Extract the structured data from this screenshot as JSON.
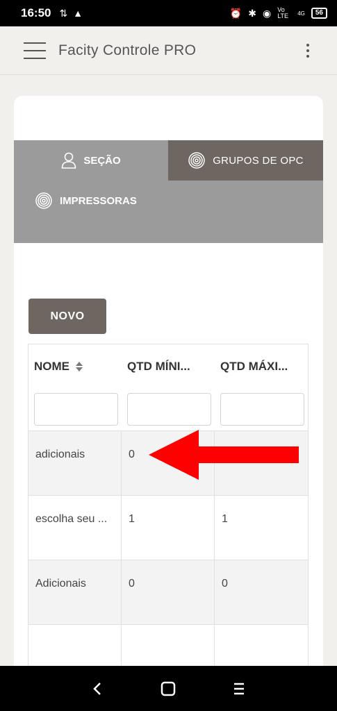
{
  "status_bar": {
    "time": "16:50",
    "battery": "56",
    "network": "Vo LTE",
    "signal_label": "4G"
  },
  "app": {
    "title": "Facity Controle PRO"
  },
  "tabs": [
    {
      "label": "SEÇÃO",
      "icon": "user-icon"
    },
    {
      "label": "GRUPOS DE OPC",
      "icon": "fingerprint-icon"
    },
    {
      "label": "IMPRESSORAS",
      "icon": "fingerprint-icon"
    }
  ],
  "novo_label": "NOVO",
  "table": {
    "columns": [
      "NOME",
      "QTD MÍNI...",
      "QTD MÁXI..."
    ],
    "rows": [
      [
        "adicionais",
        "0",
        ""
      ],
      [
        "escolha seu ...",
        "1",
        "1"
      ],
      [
        "Adicionais",
        "0",
        "0"
      ],
      [
        "",
        "",
        ""
      ]
    ]
  },
  "colors": {
    "tab_active": "#6e6761",
    "tab_bar": "#9b9b9b",
    "button": "#6e6761",
    "arrow": "#ff0000"
  }
}
